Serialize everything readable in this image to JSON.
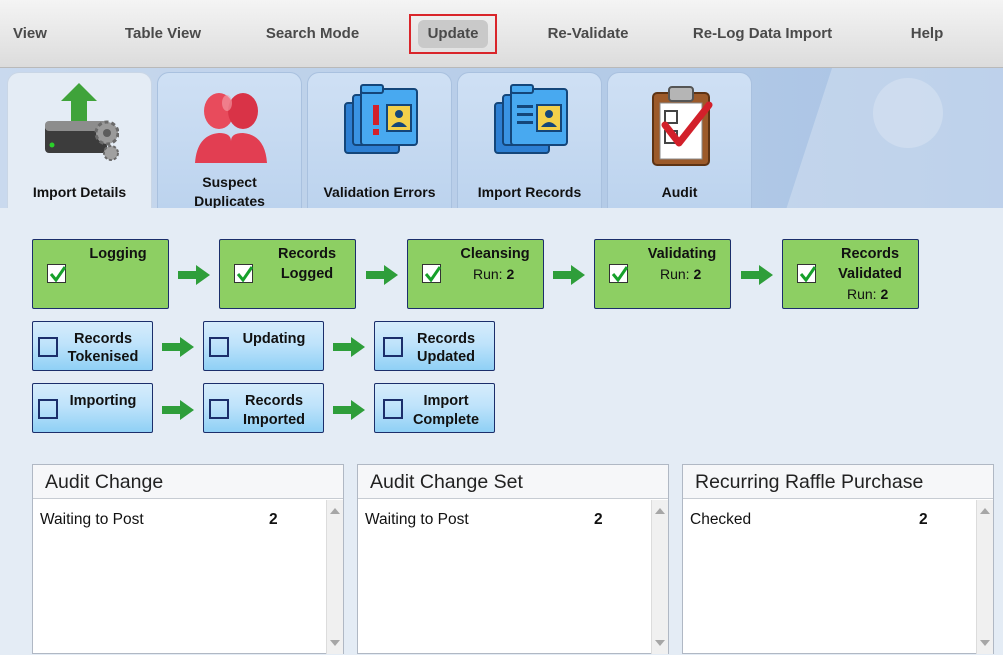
{
  "menu": {
    "items": [
      {
        "label": "View"
      },
      {
        "label": "Table View"
      },
      {
        "label": "Search Mode"
      },
      {
        "label": "Update"
      },
      {
        "label": "Re-Validate"
      },
      {
        "label": "Re-Log Data Import"
      },
      {
        "label": "Help"
      }
    ]
  },
  "tabs": [
    {
      "label": "Import Details",
      "icon": "server-import-icon"
    },
    {
      "label_line1": "Suspect",
      "label_line2": "Duplicates",
      "icon": "duplicate-people-icon"
    },
    {
      "label": "Validation Errors",
      "icon": "validation-errors-folder-icon"
    },
    {
      "label": "Import Records",
      "icon": "import-records-folder-icon"
    },
    {
      "label": "Audit",
      "icon": "audit-clipboard-icon"
    }
  ],
  "workflow": {
    "logging": {
      "title": "Logging"
    },
    "records_logged": {
      "line1": "Records",
      "line2": "Logged"
    },
    "cleansing": {
      "title": "Cleansing",
      "run_label": "Run:",
      "run_value": "2"
    },
    "validating": {
      "title": "Validating",
      "run_label": "Run:",
      "run_value": "2"
    },
    "records_validated": {
      "line1": "Records",
      "line2": "Validated",
      "run_label": "Run:",
      "run_value": "2"
    },
    "records_tokenised": {
      "line1": "Records",
      "line2": "Tokenised"
    },
    "updating": {
      "title": "Updating"
    },
    "records_updated": {
      "line1": "Records",
      "line2": "Updated"
    },
    "importing": {
      "title": "Importing"
    },
    "records_imported": {
      "line1": "Records",
      "line2": "Imported"
    },
    "import_complete": {
      "line1": "Import",
      "line2": "Complete"
    }
  },
  "panels": [
    {
      "title": "Audit Change",
      "rows": [
        {
          "label": "Waiting to Post",
          "count": "2"
        }
      ]
    },
    {
      "title": "Audit Change Set",
      "rows": [
        {
          "label": "Waiting to Post",
          "count": "2"
        }
      ]
    },
    {
      "title": "Recurring Raffle Purchase",
      "rows": [
        {
          "label": "Checked",
          "count": "2"
        }
      ]
    }
  ],
  "colors": {
    "done_step": "#8dcf63",
    "pending_step": "#bfe3fb",
    "active_outline": "#d9252a",
    "arrow_green": "#2e9e3a"
  }
}
